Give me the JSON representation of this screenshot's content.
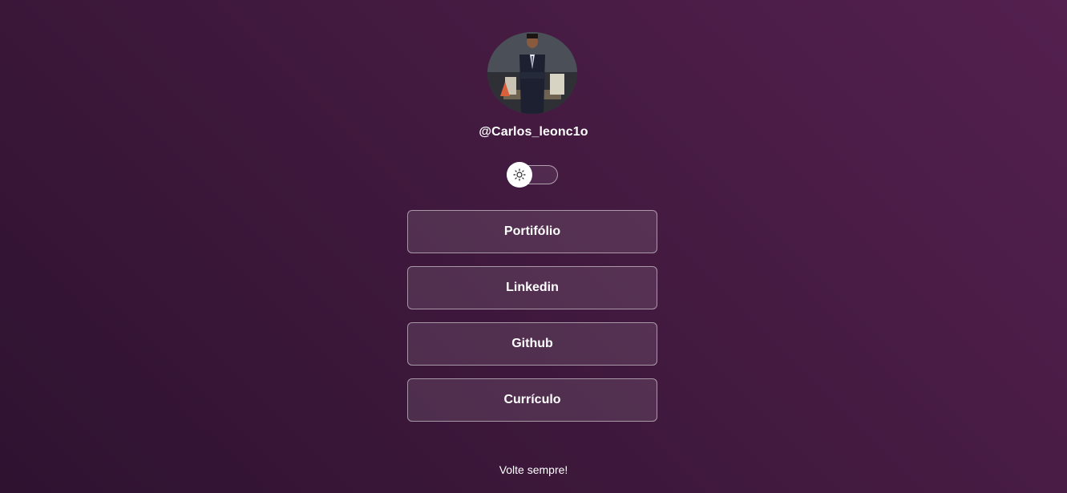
{
  "profile": {
    "username": "@Carlos_leonc1o"
  },
  "theme_toggle": {
    "icon": "sun-icon"
  },
  "links": [
    {
      "label": "Portifólio"
    },
    {
      "label": "Linkedin"
    },
    {
      "label": "Github"
    },
    {
      "label": "Currículo"
    }
  ],
  "footer": {
    "text": "Volte sempre!"
  },
  "colors": {
    "background_top_right": "#54204f",
    "background_bottom_left": "#2e1230",
    "text": "#ffffff"
  }
}
